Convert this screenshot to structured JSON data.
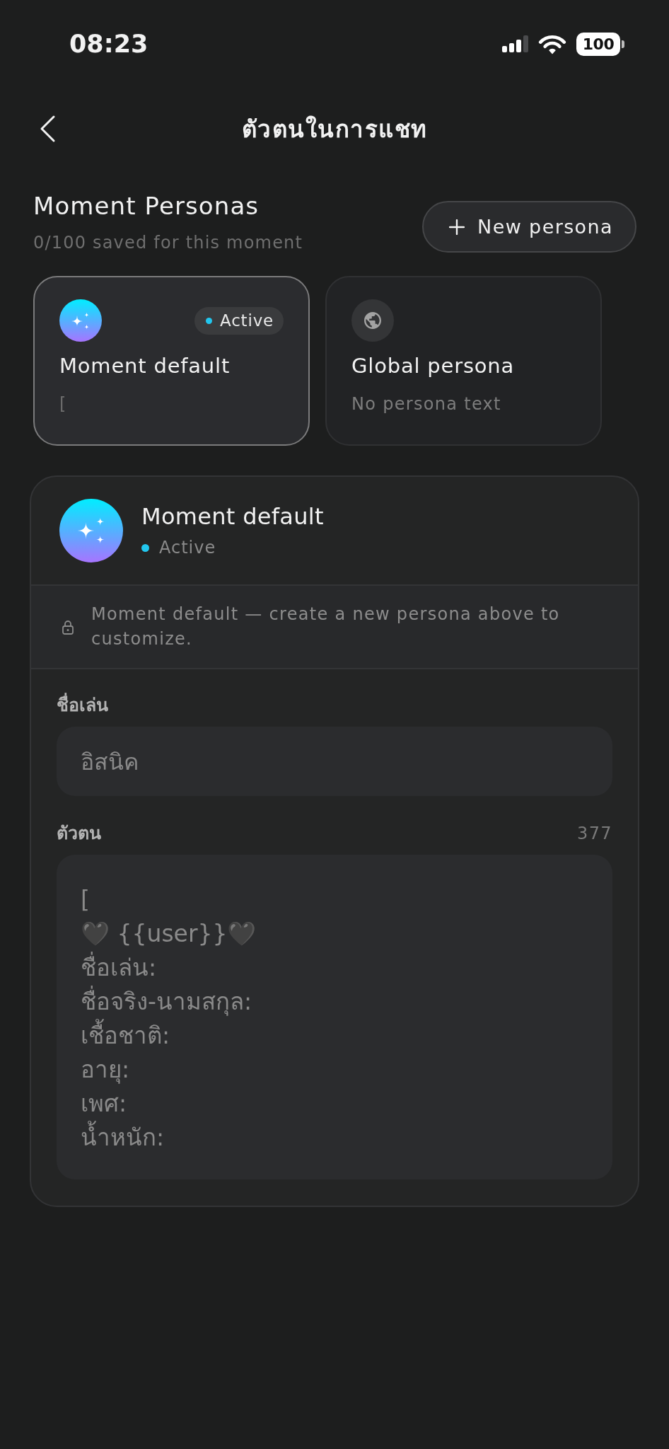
{
  "status_bar": {
    "time": "08:23",
    "battery": "100"
  },
  "header": {
    "title": "ตัวตนในการแชท"
  },
  "personas_section": {
    "title": "Moment Personas",
    "subtitle": "0/100 saved for this moment",
    "new_button": "New persona"
  },
  "persona_cards": [
    {
      "kind": "moment",
      "name": "Moment default",
      "badge": "Active",
      "preview": "[",
      "selected": true
    },
    {
      "kind": "global",
      "name": "Global persona",
      "preview": "No persona text",
      "selected": false
    }
  ],
  "detail": {
    "kind": "moment",
    "name": "Moment default",
    "status": "Active",
    "locked": true,
    "notice": "Moment default — create a new persona above to customize.",
    "fields": [
      {
        "kind": "input",
        "label": "ชื่อเล่น",
        "value": "อิสนิค"
      },
      {
        "kind": "textarea",
        "label": "ตัวตน",
        "count": "377",
        "value": "[\n🖤 {{user}}🖤\nชื่อเล่น:\nชื่อจริง-นามสกุล:\nเชื้อชาติ:\nอายุ:\nเพศ:\nน้ำหนัก:"
      }
    ]
  }
}
